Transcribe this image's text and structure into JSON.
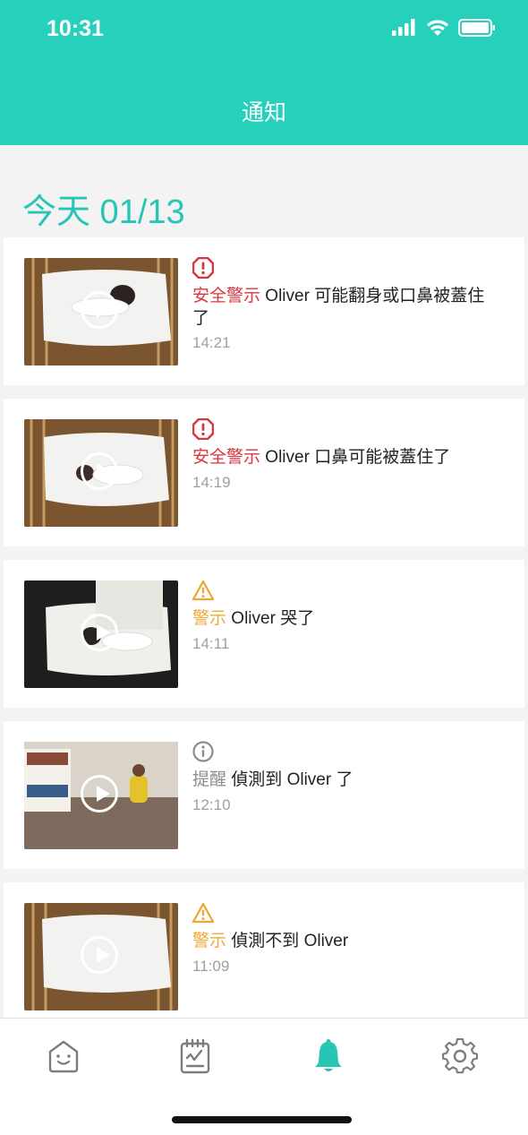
{
  "status_bar": {
    "time": "10:31"
  },
  "nav": {
    "title": "通知"
  },
  "date_heading": "今天 01/13",
  "notifications": [
    {
      "severity": "安全警示",
      "message": " Oliver 可能翻身或口鼻被蓋住了",
      "time": "14:21",
      "icon": "octagon-alert-icon",
      "color": "#d9363e"
    },
    {
      "severity": "安全警示",
      "message": " Oliver 口鼻可能被蓋住了",
      "time": "14:19",
      "icon": "octagon-alert-icon",
      "color": "#d9363e"
    },
    {
      "severity": "警示",
      "message": " Oliver 哭了",
      "time": "14:11",
      "icon": "warning-triangle-icon",
      "color": "#f0a73a"
    },
    {
      "severity": "提醒",
      "message": " 偵測到 Oliver 了",
      "time": "12:10",
      "icon": "info-circle-icon",
      "color": "#8c8c8c"
    },
    {
      "severity": "警示",
      "message": " 偵測不到 Oliver",
      "time": "11:09",
      "icon": "warning-triangle-icon",
      "color": "#f0a73a"
    }
  ],
  "tabbar": {
    "items": [
      {
        "icon": "home-face-icon",
        "active": false
      },
      {
        "icon": "journal-clipboard-icon",
        "active": false
      },
      {
        "icon": "bell-icon",
        "active": true
      },
      {
        "icon": "gear-icon",
        "active": false
      }
    ],
    "accent": "#27c6b4"
  },
  "colors": {
    "header": "#27d0bb",
    "accent": "#27c6b4"
  }
}
